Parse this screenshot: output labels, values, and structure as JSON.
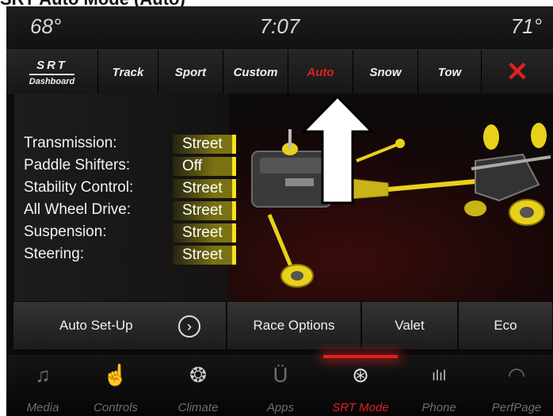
{
  "caption": "SRT Auto Mode (Auto)",
  "status": {
    "outside_temp_left": "68°",
    "clock": "7:07",
    "outside_temp_right": "71°"
  },
  "tabs": [
    {
      "name": "tab-srt-dashboard",
      "line1": "SRT",
      "line2": "Dashboard",
      "logo": true
    },
    {
      "name": "tab-track",
      "label": "Track"
    },
    {
      "name": "tab-sport",
      "label": "Sport"
    },
    {
      "name": "tab-custom",
      "label": "Custom"
    },
    {
      "name": "tab-auto",
      "label": "Auto",
      "active": true
    },
    {
      "name": "tab-snow",
      "label": "Snow"
    },
    {
      "name": "tab-tow",
      "label": "Tow"
    },
    {
      "name": "close-button",
      "label": "✕",
      "close": true
    }
  ],
  "settings": [
    {
      "label": "Transmission:",
      "value": "Street"
    },
    {
      "label": "Paddle Shifters:",
      "value": "Off"
    },
    {
      "label": "Stability Control:",
      "value": "Street"
    },
    {
      "label": "All Wheel Drive:",
      "value": "Street"
    },
    {
      "label": "Suspension:",
      "value": "Street"
    },
    {
      "label": "Steering:",
      "value": "Street"
    }
  ],
  "actions": {
    "auto_setup": "Auto Set-Up",
    "race_options": "Race Options",
    "valet": "Valet",
    "eco": "Eco",
    "chevron": "›"
  },
  "dock": [
    {
      "icon": "music-note-icon",
      "glyph": "♫",
      "label": "Media"
    },
    {
      "icon": "controls-hand-icon",
      "glyph": "☝",
      "label": "Controls"
    },
    {
      "icon": "climate-fan-icon",
      "glyph": "❂",
      "label": "Climate"
    },
    {
      "icon": "apps-icon",
      "glyph": "Ü",
      "label": "Apps"
    },
    {
      "icon": "steering-wheel-icon",
      "glyph": "⊛",
      "label": "SRT Mode",
      "active": true
    },
    {
      "icon": "phone-signal-icon",
      "glyph": "ılıl",
      "label": "Phone"
    },
    {
      "icon": "gauge-icon",
      "glyph": "◠",
      "label": "PerfPage"
    }
  ],
  "colors": {
    "accent_red": "#e02020",
    "setting_bar_yellow": "#f4e31c",
    "background": "#0b0b0b"
  }
}
